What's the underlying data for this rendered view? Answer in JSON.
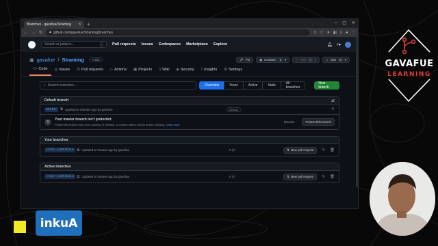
{
  "browser": {
    "tab_title": "Branches · gavafue/Straming",
    "url": "github.com/gavafue/Straming/branches"
  },
  "github": {
    "search_placeholder": "Search or jump to...",
    "search_key": "/",
    "nav": [
      "Pull requests",
      "Issues",
      "Codespaces",
      "Marketplace",
      "Explore"
    ]
  },
  "repo": {
    "owner": "gavafue",
    "separator": "/",
    "name": "Straming",
    "visibility": "Public",
    "pin_label": "Pin",
    "unwatch_label": "Unwatch",
    "unwatch_count": "1",
    "fork_label": "Fork",
    "fork_count": "0",
    "star_label": "Star",
    "star_count": "0",
    "tabs": [
      {
        "label": "Code",
        "icon": "<>"
      },
      {
        "label": "Issues",
        "icon": "◎"
      },
      {
        "label": "Pull requests",
        "icon": "⇅"
      },
      {
        "label": "Actions",
        "icon": "▷"
      },
      {
        "label": "Projects",
        "icon": "▦"
      },
      {
        "label": "Wiki",
        "icon": "▯"
      },
      {
        "label": "Security",
        "icon": "◈"
      },
      {
        "label": "Insights",
        "icon": "⌇"
      },
      {
        "label": "Settings",
        "icon": "⚙"
      }
    ]
  },
  "branches": {
    "search_placeholder": "Search branches...",
    "filters": [
      "Overview",
      "Yours",
      "Active",
      "Stale",
      "All branches"
    ],
    "new_branch_label": "New branch",
    "default_section": {
      "title": "Default branch",
      "branch": "master",
      "updated": "Updated 5 minutes ago by gavafue",
      "badge": "Default"
    },
    "protect": {
      "title": "Your master branch isn't protected",
      "desc": "Protect this branch from force pushing or deletion, or require status checks before merging.",
      "link": "Learn more",
      "dismiss": "Dismiss",
      "button": "Protect this branch"
    },
    "yours_section": {
      "title": "Your branches",
      "branch": "crear-subtitulo",
      "updated": "Updated 5 minutes ago by gavafue",
      "ahead_behind": "0 | 0",
      "pr_label": "New pull request"
    },
    "active_section": {
      "title": "Active branches",
      "branch": "crear-subtitulo",
      "updated": "Updated 5 minutes ago by gavafue",
      "ahead_behind": "0 | 0",
      "pr_label": "New pull request"
    }
  },
  "overlay": {
    "brand_name": "GAVAFUE",
    "brand_sub": "LEARNING",
    "sponsor": "inkuA"
  }
}
